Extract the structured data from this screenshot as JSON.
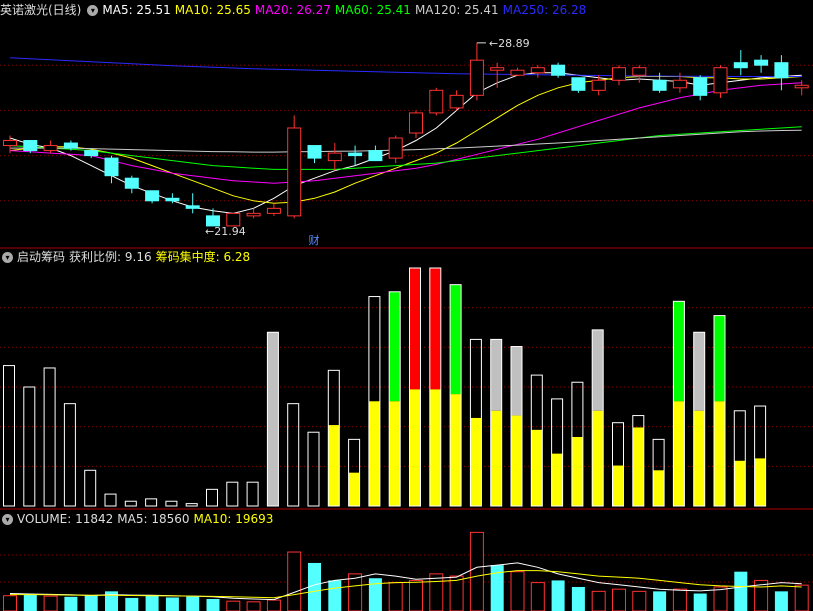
{
  "colors": {
    "up": "#ff3232",
    "down": "#54ffff",
    "ma5": "#ffffff",
    "ma10": "#ffff00",
    "ma20": "#ff00ff",
    "ma60": "#00ff00",
    "ma120": "#cccccc",
    "ma250": "#2a2aff",
    "grid": "#8b0000",
    "yellow": "#ffff00",
    "green": "#00ff00",
    "red": "#ff0000",
    "gray": "#c0c0c0"
  },
  "price_panel": {
    "title": "英诺激光(日线)",
    "legend": [
      {
        "label": "MA5: 25.51",
        "color": "#ffffff"
      },
      {
        "label": "MA10: 25.65",
        "color": "#ffff00"
      },
      {
        "label": "MA20: 26.27",
        "color": "#ff00ff"
      },
      {
        "label": "MA60: 25.41",
        "color": "#00ff00"
      },
      {
        "label": "MA120: 25.41",
        "color": "#cccccc"
      },
      {
        "label": "MA250: 26.28",
        "color": "#2a2aff"
      }
    ],
    "high_label": "28.89",
    "low_label": "21.94",
    "fin_marker": "财"
  },
  "chip_panel": {
    "legend": [
      {
        "label": "启动筹码",
        "color": "#dddddd"
      },
      {
        "label": "获利比例: 9.16",
        "color": "#dddddd"
      },
      {
        "label": "筹码集中度: 6.28",
        "color": "#ffff00"
      }
    ]
  },
  "volume_panel": {
    "legend": [
      {
        "label": "VOLUME: 11842",
        "color": "#dddddd"
      },
      {
        "label": "MA5: 18560",
        "color": "#dddddd"
      },
      {
        "label": "MA10: 19693",
        "color": "#ffff00"
      }
    ]
  },
  "chart_data": {
    "type": "candlestick",
    "price_range": [
      20.8,
      29.8
    ],
    "candles": [
      {
        "o": 24.8,
        "h": 25.2,
        "l": 24.5,
        "c": 25.0
      },
      {
        "o": 25.0,
        "h": 24.9,
        "l": 24.5,
        "c": 24.6
      },
      {
        "o": 24.6,
        "h": 25.0,
        "l": 24.5,
        "c": 24.8
      },
      {
        "o": 24.9,
        "h": 25.0,
        "l": 24.6,
        "c": 24.7
      },
      {
        "o": 24.6,
        "h": 24.7,
        "l": 24.3,
        "c": 24.4
      },
      {
        "o": 24.3,
        "h": 24.4,
        "l": 23.3,
        "c": 23.6
      },
      {
        "o": 23.5,
        "h": 23.6,
        "l": 22.9,
        "c": 23.1
      },
      {
        "o": 23.0,
        "h": 23.0,
        "l": 22.5,
        "c": 22.6
      },
      {
        "o": 22.7,
        "h": 22.9,
        "l": 22.5,
        "c": 22.6
      },
      {
        "o": 22.4,
        "h": 22.9,
        "l": 22.1,
        "c": 22.3
      },
      {
        "o": 22.0,
        "h": 22.3,
        "l": 21.6,
        "c": 21.6
      },
      {
        "o": 21.6,
        "h": 22.1,
        "l": 21.94,
        "c": 22.1
      },
      {
        "o": 22.0,
        "h": 22.3,
        "l": 21.9,
        "c": 22.1
      },
      {
        "o": 22.1,
        "h": 22.5,
        "l": 22.0,
        "c": 22.3
      },
      {
        "o": 22.0,
        "h": 26.0,
        "l": 21.9,
        "c": 25.5
      },
      {
        "o": 24.8,
        "h": 24.8,
        "l": 24.1,
        "c": 24.3
      },
      {
        "o": 24.2,
        "h": 24.9,
        "l": 23.8,
        "c": 24.5
      },
      {
        "o": 24.5,
        "h": 24.8,
        "l": 24.0,
        "c": 24.4
      },
      {
        "o": 24.6,
        "h": 24.8,
        "l": 24.2,
        "c": 24.2
      },
      {
        "o": 24.3,
        "h": 25.2,
        "l": 24.1,
        "c": 25.1
      },
      {
        "o": 25.3,
        "h": 26.2,
        "l": 25.1,
        "c": 26.1
      },
      {
        "o": 26.1,
        "h": 27.1,
        "l": 26.0,
        "c": 27.0
      },
      {
        "o": 26.3,
        "h": 27.0,
        "l": 26.2,
        "c": 26.8
      },
      {
        "o": 26.8,
        "h": 28.89,
        "l": 26.6,
        "c": 28.2
      },
      {
        "o": 27.8,
        "h": 28.1,
        "l": 27.1,
        "c": 27.9
      },
      {
        "o": 27.6,
        "h": 27.9,
        "l": 27.6,
        "c": 27.8
      },
      {
        "o": 27.7,
        "h": 28.0,
        "l": 27.5,
        "c": 27.9
      },
      {
        "o": 28.0,
        "h": 28.1,
        "l": 27.5,
        "c": 27.6
      },
      {
        "o": 27.5,
        "h": 27.5,
        "l": 26.9,
        "c": 27.0
      },
      {
        "o": 27.0,
        "h": 27.6,
        "l": 26.8,
        "c": 27.4
      },
      {
        "o": 27.4,
        "h": 28.0,
        "l": 27.2,
        "c": 27.9
      },
      {
        "o": 27.6,
        "h": 28.0,
        "l": 27.3,
        "c": 27.9
      },
      {
        "o": 27.4,
        "h": 27.7,
        "l": 26.9,
        "c": 27.0
      },
      {
        "o": 27.1,
        "h": 27.7,
        "l": 26.9,
        "c": 27.4
      },
      {
        "o": 27.5,
        "h": 27.6,
        "l": 26.6,
        "c": 26.8
      },
      {
        "o": 26.9,
        "h": 28.0,
        "l": 26.7,
        "c": 27.9
      },
      {
        "o": 28.1,
        "h": 28.6,
        "l": 27.6,
        "c": 27.9
      },
      {
        "o": 28.2,
        "h": 28.4,
        "l": 27.7,
        "c": 28.0
      },
      {
        "o": 28.1,
        "h": 28.4,
        "l": 27.0,
        "c": 27.5
      },
      {
        "o": 27.1,
        "h": 27.4,
        "l": 26.8,
        "c": 27.2
      }
    ],
    "ma": {
      "ma5": [
        25.1,
        24.85,
        24.7,
        24.4,
        24.0,
        23.6,
        23.2,
        22.9,
        22.6,
        22.35,
        22.2,
        22.1,
        22.3,
        22.7,
        23.2,
        23.5,
        23.8,
        24.0,
        24.3,
        24.6,
        25.0,
        25.5,
        26.2,
        26.9,
        27.3,
        27.6,
        27.7,
        27.7,
        27.6,
        27.5,
        27.4,
        27.45,
        27.4,
        27.35,
        27.2,
        27.3,
        27.4,
        27.5,
        27.55,
        27.6
      ],
      "ma10": [
        24.6,
        24.7,
        24.75,
        24.75,
        24.65,
        24.5,
        24.3,
        24.0,
        23.7,
        23.4,
        23.1,
        22.8,
        22.6,
        22.5,
        22.55,
        22.7,
        22.95,
        23.3,
        23.6,
        23.9,
        24.2,
        24.5,
        24.9,
        25.4,
        25.9,
        26.4,
        26.8,
        27.1,
        27.3,
        27.4,
        27.5,
        27.55,
        27.55,
        27.55,
        27.5,
        27.5,
        27.45,
        27.45,
        27.5,
        27.55
      ],
      "ma20": [
        24.6,
        24.55,
        24.5,
        24.45,
        24.4,
        24.2,
        24.0,
        23.85,
        23.7,
        23.6,
        23.5,
        23.4,
        23.35,
        23.3,
        23.35,
        23.4,
        23.5,
        23.6,
        23.7,
        23.8,
        23.9,
        24.05,
        24.25,
        24.45,
        24.65,
        24.85,
        25.05,
        25.3,
        25.55,
        25.8,
        26.05,
        26.3,
        26.5,
        26.7,
        26.85,
        27.0,
        27.1,
        27.2,
        27.25,
        27.3
      ],
      "ma60": [
        24.8,
        24.75,
        24.7,
        24.65,
        24.6,
        24.5,
        24.4,
        24.3,
        24.2,
        24.1,
        24.0,
        23.95,
        23.9,
        23.85,
        23.85,
        23.85,
        23.85,
        23.9,
        23.95,
        24.0,
        24.05,
        24.1,
        24.2,
        24.3,
        24.4,
        24.5,
        24.6,
        24.7,
        24.8,
        24.9,
        25.0,
        25.1,
        25.2,
        25.25,
        25.3,
        25.35,
        25.4,
        25.45,
        25.5,
        25.55
      ],
      "ma120": [
        24.7,
        24.7,
        24.7,
        24.7,
        24.68,
        24.66,
        24.64,
        24.62,
        24.6,
        24.58,
        24.56,
        24.55,
        24.54,
        24.54,
        24.55,
        24.56,
        24.57,
        24.58,
        24.6,
        24.62,
        24.64,
        24.67,
        24.7,
        24.74,
        24.78,
        24.82,
        24.86,
        24.9,
        24.95,
        25.0,
        25.05,
        25.1,
        25.15,
        25.2,
        25.25,
        25.3,
        25.35,
        25.38,
        25.4,
        25.41
      ],
      "ma250": [
        28.3,
        28.26,
        28.22,
        28.18,
        28.14,
        28.1,
        28.06,
        28.02,
        27.98,
        27.95,
        27.92,
        27.89,
        27.86,
        27.84,
        27.82,
        27.8,
        27.78,
        27.76,
        27.74,
        27.72,
        27.7,
        27.68,
        27.66,
        27.65,
        27.64,
        27.63,
        27.62,
        27.61,
        27.6,
        27.59,
        27.58,
        27.57,
        27.57,
        27.56,
        27.56,
        27.55,
        27.55,
        27.55,
        27.55,
        27.55
      ]
    },
    "chip_bars": {
      "range": [
        0,
        100
      ],
      "bars": [
        {
          "h": 59,
          "y": 0,
          "c": ""
        },
        {
          "h": 50,
          "y": 0,
          "c": ""
        },
        {
          "h": 58,
          "y": 0,
          "c": ""
        },
        {
          "h": 43,
          "y": 0,
          "c": ""
        },
        {
          "h": 15,
          "y": 0,
          "c": ""
        },
        {
          "h": 5,
          "y": 0,
          "c": ""
        },
        {
          "h": 2,
          "y": 0,
          "c": ""
        },
        {
          "h": 3,
          "y": 0,
          "c": ""
        },
        {
          "h": 2,
          "y": 0,
          "c": ""
        },
        {
          "h": 1,
          "y": 0,
          "c": ""
        },
        {
          "h": 7,
          "y": 0,
          "c": ""
        },
        {
          "h": 10,
          "y": 0,
          "c": ""
        },
        {
          "h": 10,
          "y": 0,
          "c": ""
        },
        {
          "h": 73,
          "y": 0,
          "c": "gray"
        },
        {
          "h": 43,
          "y": 0,
          "c": ""
        },
        {
          "h": 31,
          "y": 0,
          "c": ""
        },
        {
          "h": 57,
          "y": 34,
          "c": ""
        },
        {
          "h": 28,
          "y": 14,
          "c": ""
        },
        {
          "h": 88,
          "y": 44,
          "c": ""
        },
        {
          "h": 90,
          "y": 44,
          "c": "green"
        },
        {
          "h": 100,
          "y": 49,
          "c": "red"
        },
        {
          "h": 100,
          "y": 49,
          "c": "red"
        },
        {
          "h": 93,
          "y": 47,
          "c": "green"
        },
        {
          "h": 70,
          "y": 37,
          "c": ""
        },
        {
          "h": 70,
          "y": 40,
          "c": "gray"
        },
        {
          "h": 67,
          "y": 38,
          "c": "gray"
        },
        {
          "h": 55,
          "y": 32,
          "c": ""
        },
        {
          "h": 45,
          "y": 22,
          "c": ""
        },
        {
          "h": 52,
          "y": 29,
          "c": ""
        },
        {
          "h": 74,
          "y": 40,
          "c": "gray"
        },
        {
          "h": 35,
          "y": 17,
          "c": ""
        },
        {
          "h": 38,
          "y": 33,
          "c": ""
        },
        {
          "h": 28,
          "y": 15,
          "c": ""
        },
        {
          "h": 86,
          "y": 44,
          "c": "green"
        },
        {
          "h": 73,
          "y": 40,
          "c": "gray"
        },
        {
          "h": 80,
          "y": 44,
          "c": "green"
        },
        {
          "h": 40,
          "y": 19,
          "c": ""
        },
        {
          "h": 42,
          "y": 20,
          "c": ""
        }
      ]
    },
    "volume": {
      "range": [
        0,
        38000
      ],
      "bars": [
        {
          "v": 7000,
          "up": true
        },
        {
          "v": 7500,
          "up": false
        },
        {
          "v": 6800,
          "up": true
        },
        {
          "v": 6500,
          "up": false
        },
        {
          "v": 7200,
          "up": false
        },
        {
          "v": 9000,
          "up": false
        },
        {
          "v": 6000,
          "up": false
        },
        {
          "v": 7000,
          "up": false
        },
        {
          "v": 6200,
          "up": false
        },
        {
          "v": 6600,
          "up": false
        },
        {
          "v": 5500,
          "up": false
        },
        {
          "v": 4500,
          "up": true
        },
        {
          "v": 4200,
          "up": true
        },
        {
          "v": 5000,
          "up": true
        },
        {
          "v": 27000,
          "up": true
        },
        {
          "v": 22000,
          "up": false
        },
        {
          "v": 14000,
          "up": false
        },
        {
          "v": 17000,
          "up": true
        },
        {
          "v": 15000,
          "up": false
        },
        {
          "v": 13000,
          "up": true
        },
        {
          "v": 14000,
          "up": true
        },
        {
          "v": 17000,
          "up": true
        },
        {
          "v": 16000,
          "up": true
        },
        {
          "v": 36000,
          "up": true
        },
        {
          "v": 21000,
          "up": false
        },
        {
          "v": 18000,
          "up": true
        },
        {
          "v": 13000,
          "up": true
        },
        {
          "v": 14000,
          "up": false
        },
        {
          "v": 11000,
          "up": false
        },
        {
          "v": 9000,
          "up": true
        },
        {
          "v": 10000,
          "up": true
        },
        {
          "v": 9000,
          "up": true
        },
        {
          "v": 9000,
          "up": false
        },
        {
          "v": 10000,
          "up": true
        },
        {
          "v": 8000,
          "up": false
        },
        {
          "v": 11000,
          "up": true
        },
        {
          "v": 18000,
          "up": false
        },
        {
          "v": 14000,
          "up": true
        },
        {
          "v": 9000,
          "up": false
        },
        {
          "v": 11842,
          "up": true
        }
      ],
      "ma5": [
        8000,
        7800,
        7600,
        7400,
        7100,
        7500,
        7300,
        7200,
        7000,
        6800,
        6500,
        5800,
        5500,
        5200,
        8500,
        12000,
        14000,
        15000,
        17000,
        16000,
        14500,
        15000,
        15500,
        20000,
        21000,
        22000,
        20000,
        17000,
        15000,
        13000,
        12000,
        11000,
        10000,
        9500,
        9200,
        9800,
        11000,
        12000,
        13000,
        12500
      ],
      "ma10": [
        7500,
        7500,
        7400,
        7300,
        7200,
        7200,
        7100,
        7000,
        6900,
        6800,
        6700,
        6500,
        6300,
        6100,
        7500,
        9000,
        10500,
        11500,
        12500,
        13000,
        13200,
        13500,
        14000,
        16000,
        17500,
        18500,
        18500,
        18000,
        17000,
        16000,
        15500,
        15000,
        14000,
        13000,
        12000,
        11500,
        11200,
        11000,
        11500,
        11000
      ]
    }
  }
}
